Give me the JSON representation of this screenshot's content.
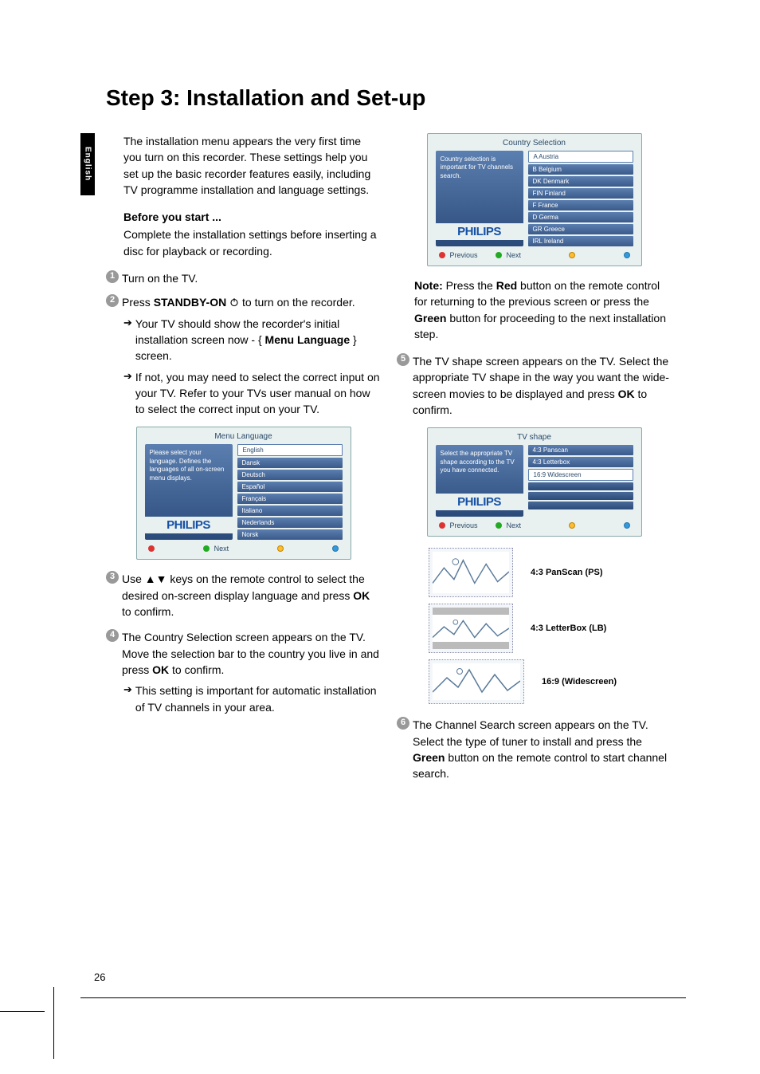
{
  "language_tab": "English",
  "page_title": "Step 3: Installation and Set-up",
  "page_number": "26",
  "left": {
    "intro": "The installation menu appears the very first time you turn on this recorder. These settings help you set up the basic recorder features easily, including TV programme installation and language settings.",
    "before_heading": "Before you start ...",
    "before_text": "Complete the installation settings before inserting a disc for playback or recording.",
    "step1": "Turn on the TV.",
    "step2_a": "Press ",
    "step2_b": "STANDBY-ON",
    "step2_c": " to turn on the recorder.",
    "step2_sub1_a": "Your TV should show the recorder's initial installation screen now - { ",
    "step2_sub1_b": "Menu Language",
    "step2_sub1_c": " } screen.",
    "step2_sub2": "If not, you may need to select the correct input on your TV.  Refer to your TVs user manual on how to select the correct input on your TV.",
    "step3_a": "Use ▲▼ keys on the remote control to select the desired on-screen display language and press ",
    "step3_b": "OK",
    "step3_c": " to confirm.",
    "step4_a": "The Country Selection screen appears on the TV.  Move the selection bar to the country you live in and press ",
    "step4_b": "OK",
    "step4_c": " to confirm.",
    "step4_sub": "This setting is important for automatic installation of TV channels in your area."
  },
  "right": {
    "note_a": "Note:",
    "note_b": " Press the ",
    "note_c": "Red",
    "note_d": " button on the remote control for returning to the previous screen or press the ",
    "note_e": "Green",
    "note_f": " button for proceeding to the next installation step.",
    "step5_a": "The TV shape screen appears on the TV. Select the appropriate TV shape in the way you want the wide-screen movies to be displayed and press ",
    "step5_b": "OK",
    "step5_c": " to confirm.",
    "shape1": "4:3 PanScan (PS)",
    "shape2": "4:3 LetterBox (LB)",
    "shape3": "16:9 (Widescreen)",
    "step6_a": "The Channel Search screen appears on the TV.  Select the type of tuner to install and press the ",
    "step6_b": "Green",
    "step6_c": " button on the remote control to start channel search."
  },
  "osd_menu_lang": {
    "title": "Menu Language",
    "hint": "Please select your language. Defines the languages of all on-screen menu displays.",
    "items": [
      "English",
      "Dansk",
      "Deutsch",
      "Español",
      "Français",
      "Italiano",
      "Nederlands",
      "Norsk"
    ],
    "selected_index": 0,
    "next": "Next"
  },
  "osd_country": {
    "title": "Country Selection",
    "hint": "Country selection is important for TV channels search.",
    "items": [
      "A  Austria",
      "B  Belgium",
      "DK  Denmark",
      "FIN  Finland",
      "F  France",
      "D  Germa",
      "GR  Greece",
      "IRL Ireland"
    ],
    "selected_index": 0,
    "previous": "Previous",
    "next": "Next"
  },
  "osd_tvshape": {
    "title": "TV shape",
    "hint": "Select the appropriate TV shape according to the TV you have connected.",
    "items": [
      "4:3 Panscan",
      "4:3 Letterbox",
      "16:9 Widescreen"
    ],
    "selected_index": 2,
    "previous": "Previous",
    "next": "Next"
  },
  "brand": "PHILIPS",
  "step_labels": {
    "1": "1",
    "2": "2",
    "3": "3",
    "4": "4",
    "5": "5",
    "6": "6"
  }
}
